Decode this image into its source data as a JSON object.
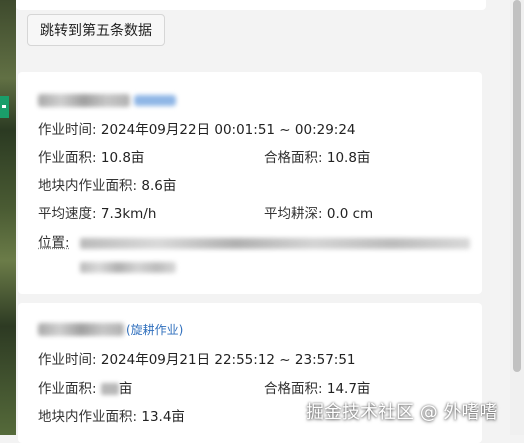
{
  "toolbar": {
    "jump_label": "跳转到第五条数据"
  },
  "records": [
    {
      "type_tag": "",
      "time_label": "作业时间:",
      "time_value": "2024年09月22日 00:01:51 ~ 00:29:24",
      "area_label": "作业面积:",
      "area_value": "10.8亩",
      "qualified_label": "合格面积:",
      "qualified_value": "10.8亩",
      "plot_area_label": "地块内作业面积:",
      "plot_area_value": "8.6亩",
      "speed_label": "平均速度:",
      "speed_value": "7.3km/h",
      "depth_label": "平均耕深:",
      "depth_value": "0.0 cm",
      "location_label": "位置:"
    },
    {
      "type_tag": "(旋耕作业)",
      "time_label": "作业时间:",
      "time_value": "2024年09月21日 22:55:12 ~ 23:57:51",
      "area_label": "作业面积:",
      "area_unit": "亩",
      "qualified_label": "合格面积:",
      "qualified_value": "14.7亩",
      "plot_area_label": "地块内作业面积:",
      "plot_area_value": "13.4亩"
    }
  ],
  "watermark": "掘金技术社区 @ 外嗜嗜"
}
